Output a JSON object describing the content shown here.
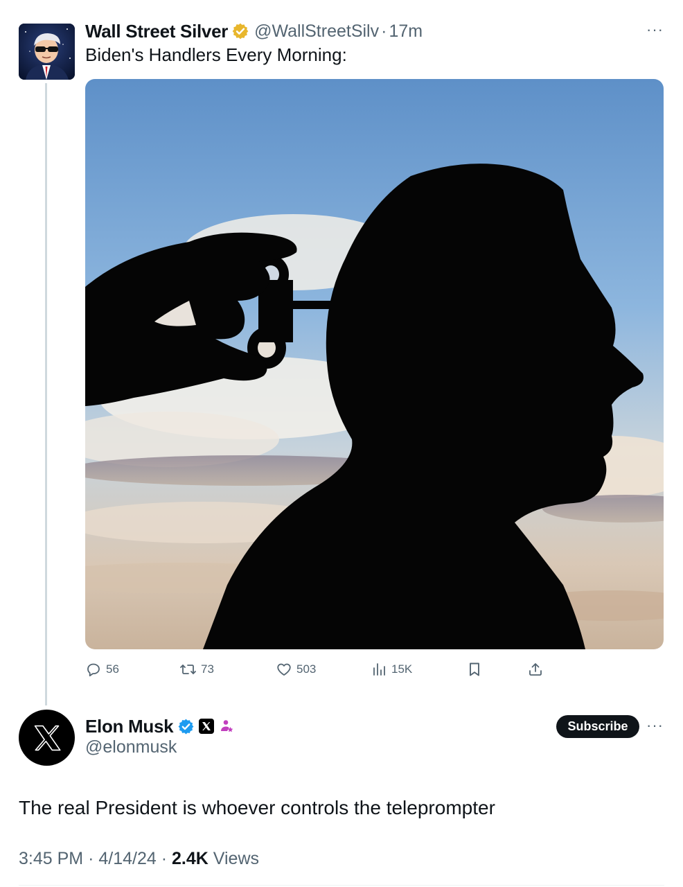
{
  "original_tweet": {
    "display_name": "Wall Street Silver",
    "handle": "@WallStreetSilv",
    "separator": "·",
    "time": "17m",
    "more": "···",
    "text": "Biden's Handlers Every Morning:",
    "verified_color": "#e8b62c",
    "avatar_icon": "cartoon-man-sunglasses-avatar",
    "media_icon": "silhouette-wind-up-key-image",
    "actions": {
      "replies": "56",
      "reposts": "73",
      "likes": "503",
      "views": "15K"
    }
  },
  "reply_tweet": {
    "display_name": "Elon Musk",
    "handle": "@elonmusk",
    "verified_color": "#1d9bf0",
    "avatar_icon": "x-logo-avatar",
    "subscribe_label": "Subscribe",
    "more": "···",
    "text": "The real President is whoever controls the teleprompter",
    "meta": {
      "time": "3:45 PM",
      "separator": "·",
      "date": "4/14/24",
      "views_count": "2.4K",
      "views_label": "Views"
    }
  },
  "colors": {
    "text_primary": "#0f1419",
    "text_secondary": "#536471",
    "thread_line": "#cfd9de"
  }
}
